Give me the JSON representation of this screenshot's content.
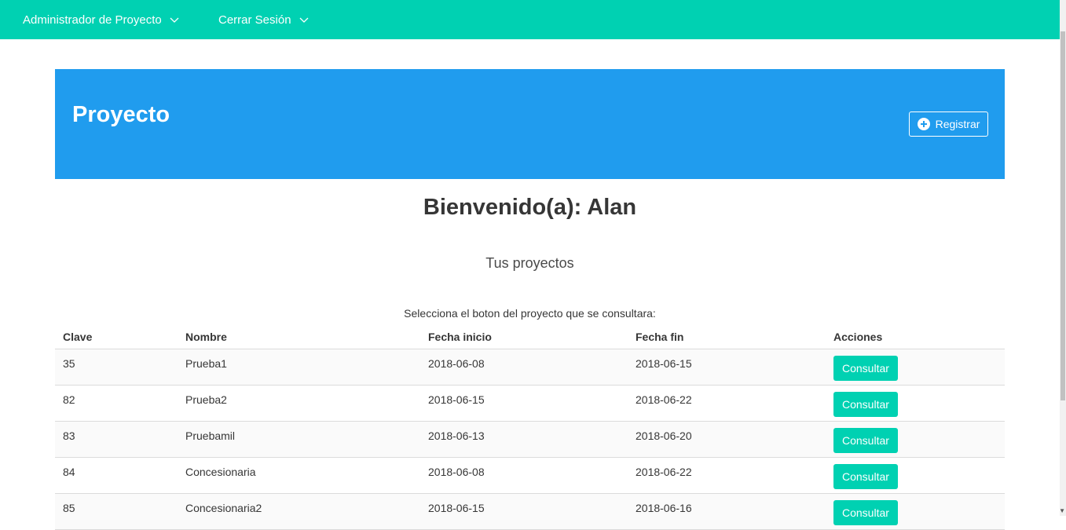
{
  "navbar": {
    "items": [
      {
        "label": "Administrador de Proyecto"
      },
      {
        "label": "Cerrar Sesión"
      }
    ]
  },
  "hero": {
    "title": "Proyecto",
    "register_label": "Registrar"
  },
  "main": {
    "welcome": "Bienvenido(a): Alan",
    "subtitle": "Tus proyectos",
    "instruction": "Selecciona el boton del proyecto que se consultara:"
  },
  "table": {
    "headers": [
      "Clave",
      "Nombre",
      "Fecha inicio",
      "Fecha fin",
      "Acciones"
    ],
    "rows": [
      {
        "clave": "35",
        "nombre": "Prueba1",
        "inicio": "2018-06-08",
        "fin": "2018-06-15",
        "action": "Consultar"
      },
      {
        "clave": "82",
        "nombre": "Prueba2",
        "inicio": "2018-06-15",
        "fin": "2018-06-22",
        "action": "Consultar"
      },
      {
        "clave": "83",
        "nombre": "Pruebamil",
        "inicio": "2018-06-13",
        "fin": "2018-06-20",
        "action": "Consultar"
      },
      {
        "clave": "84",
        "nombre": "Concesionaria",
        "inicio": "2018-06-08",
        "fin": "2018-06-22",
        "action": "Consultar"
      },
      {
        "clave": "85",
        "nombre": "Concesionaria2",
        "inicio": "2018-06-15",
        "fin": "2018-06-16",
        "action": "Consultar"
      }
    ]
  },
  "colors": {
    "navbar": "#00d1b2",
    "hero": "#209cee",
    "button": "#00d1b2"
  }
}
